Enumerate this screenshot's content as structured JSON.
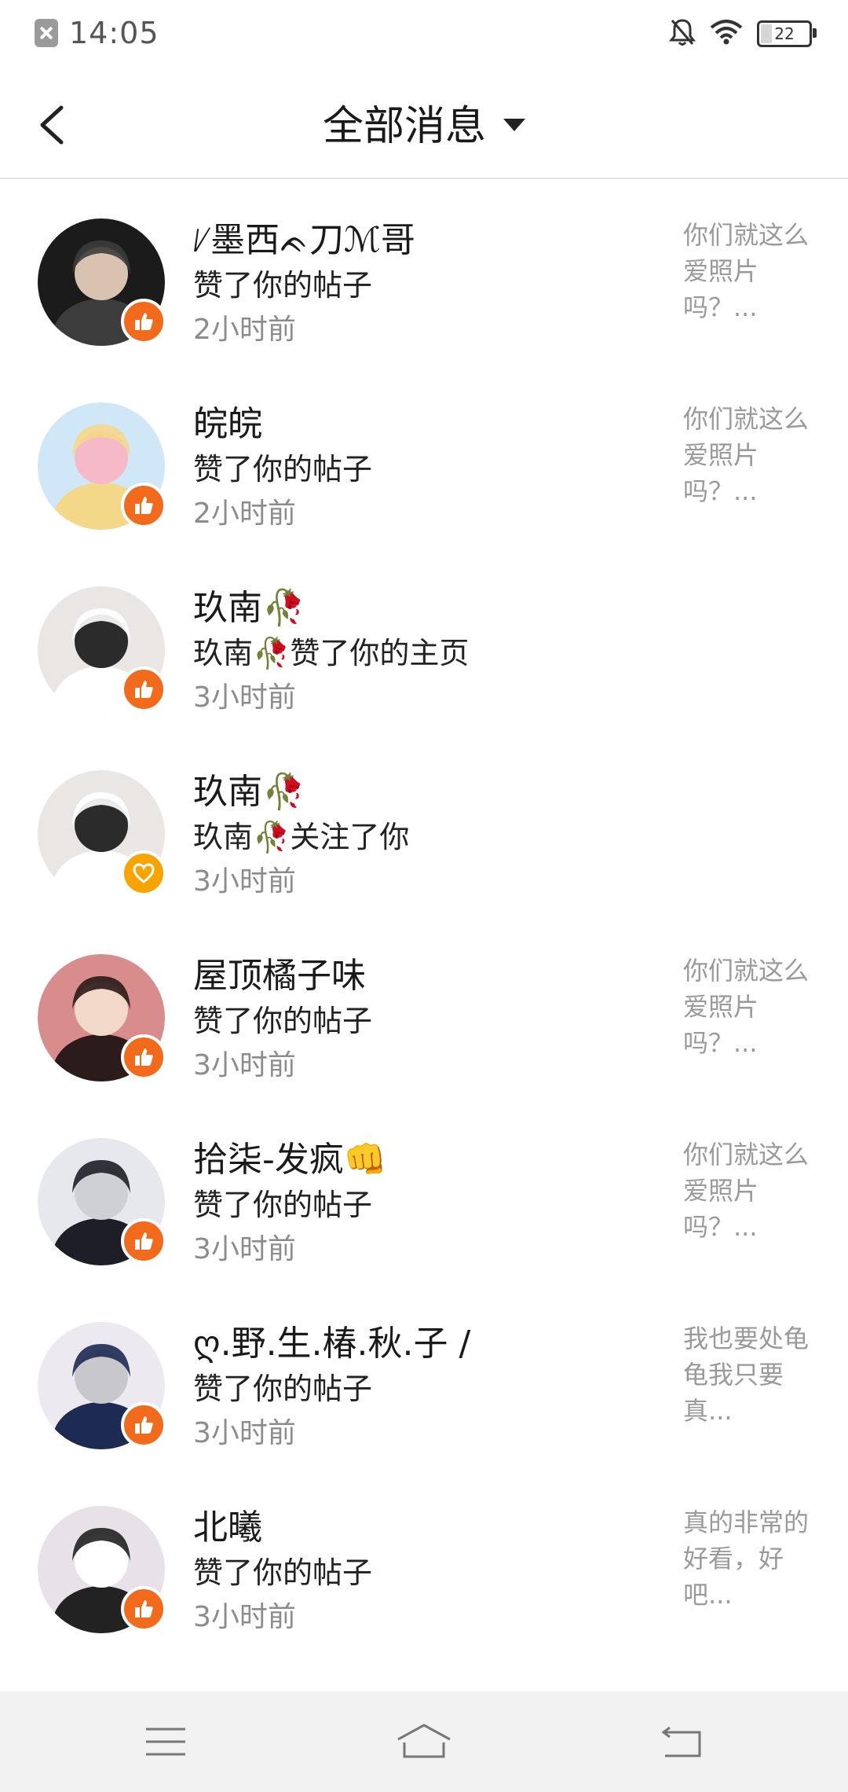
{
  "status_bar": {
    "time": "14:05",
    "battery": "22",
    "battery_level": 0.22
  },
  "header": {
    "title": "全部消息"
  },
  "colors": {
    "like_badge": "#f26a1b",
    "follow_badge": "#f7a400",
    "text_muted": "#8c8c8c",
    "nav_bg": "#f2f2f2"
  },
  "notifications": [
    {
      "name": "ᜱ墨西ᨃ刀ℳ哥",
      "action": "赞了你的帖子",
      "time": "2小时前",
      "preview": "你们就这么爱照片吗？...",
      "badge": "like-icon"
    },
    {
      "name": "皖皖",
      "action": "赞了你的帖子",
      "time": "2小时前",
      "preview": "你们就这么爱照片吗？...",
      "badge": "like-icon"
    },
    {
      "name": "玖南🥀",
      "action": "玖南🥀赞了你的主页",
      "time": "3小时前",
      "preview": "",
      "badge": "like-icon"
    },
    {
      "name": "玖南🥀",
      "action": "玖南🥀关注了你",
      "time": "3小时前",
      "preview": "",
      "badge": "heart-icon"
    },
    {
      "name": "屋顶橘子味",
      "action": "赞了你的帖子",
      "time": "3小时前",
      "preview": "你们就这么爱照片吗？...",
      "badge": "like-icon"
    },
    {
      "name": "拾柒-发疯👊",
      "action": "赞了你的帖子",
      "time": "3小时前",
      "preview": "你们就这么爱照片吗？...",
      "badge": "like-icon"
    },
    {
      "name": "ღ.野.生.椿.秋.子 /",
      "action": "赞了你的帖子",
      "time": "3小时前",
      "preview": "我也要处龟龟我只要真...",
      "badge": "like-icon"
    },
    {
      "name": "北曦",
      "action": "赞了你的帖子",
      "time": "3小时前",
      "preview": "真的非常的好看，好吧...",
      "badge": "like-icon"
    }
  ]
}
